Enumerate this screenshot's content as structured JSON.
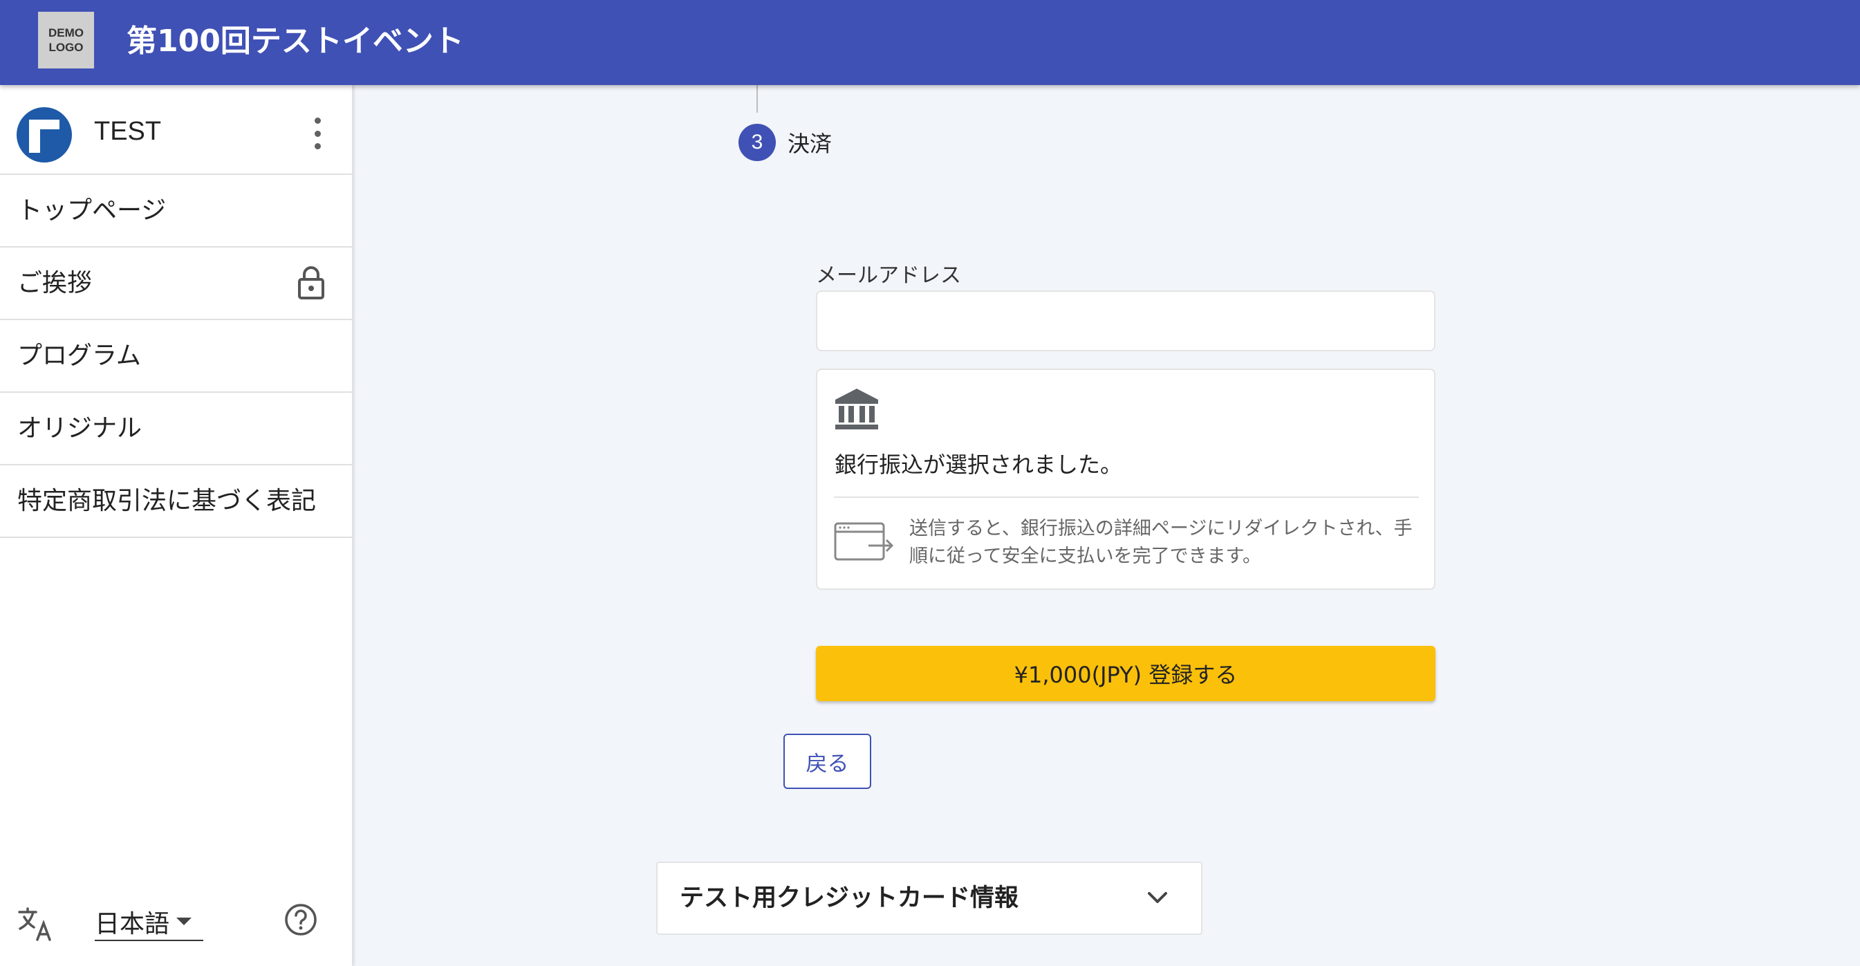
{
  "header": {
    "logo_line1": "DEMO",
    "logo_line2": "LOGO",
    "event_title": "第100回テストイベント",
    "color": "#3f51b5"
  },
  "sidebar": {
    "account_name": "TEST",
    "items": [
      {
        "label": "トップページ"
      },
      {
        "label": "ご挨拶",
        "icon": "lock-icon"
      },
      {
        "label": "プログラム"
      },
      {
        "label": "オリジナル"
      },
      {
        "label": "特定商取引法に基づく表記"
      }
    ],
    "footer": {
      "language": "日本語"
    }
  },
  "stepper": {
    "number": "3",
    "label": "決済"
  },
  "form": {
    "email_label": "メールアドレス",
    "email_value": "",
    "bank": {
      "selected_text": "銀行振込が選択されました。",
      "redirect_text": "送信すると、銀行振込の詳細ページにリダイレクトされ、手順に従って安全に支払いを完了できます。"
    },
    "submit_label": "¥1,000(JPY) 登録する",
    "submit_color": "#fbc00a",
    "back_label": "戻る"
  },
  "accordion": {
    "title": "テスト用クレジットカード情報"
  }
}
